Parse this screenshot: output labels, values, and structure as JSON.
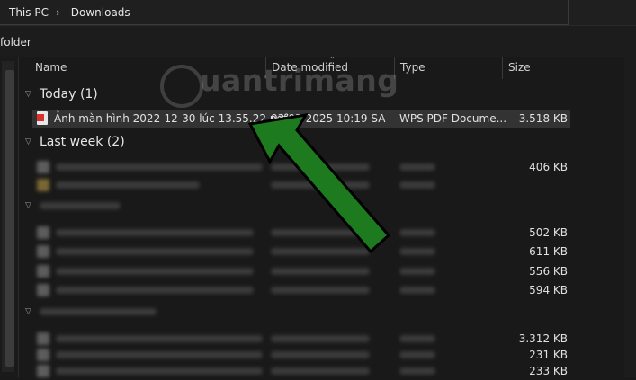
{
  "breadcrumb": {
    "root": "This PC",
    "sep": "›",
    "current": "Downloads"
  },
  "toolbar": {
    "new_folder_label": "folder"
  },
  "columns": {
    "name": "Name",
    "date": "Date modified",
    "type": "Type",
    "size": "Size"
  },
  "groups": {
    "today": {
      "label": "Today (1)"
    },
    "last_week": {
      "label": "Last week (2)"
    }
  },
  "files": {
    "f1": {
      "name": "Ảnh màn hình 2022-12-30 lúc 13.55.22.pdf",
      "date": "03/03/2025 10:19 SA",
      "type": "WPS PDF Docume...",
      "size": "3.518 KB"
    }
  },
  "blurred_sizes": [
    "406 KB",
    "502 KB",
    "611 KB",
    "556 KB",
    "594 KB",
    "3.312 KB",
    "231 KB",
    "233 KB"
  ],
  "watermark": {
    "text": "uantrimang"
  },
  "colors": {
    "arrow_fill": "#1e7a1e",
    "arrow_stroke": "#000000",
    "selection": "#333333"
  }
}
